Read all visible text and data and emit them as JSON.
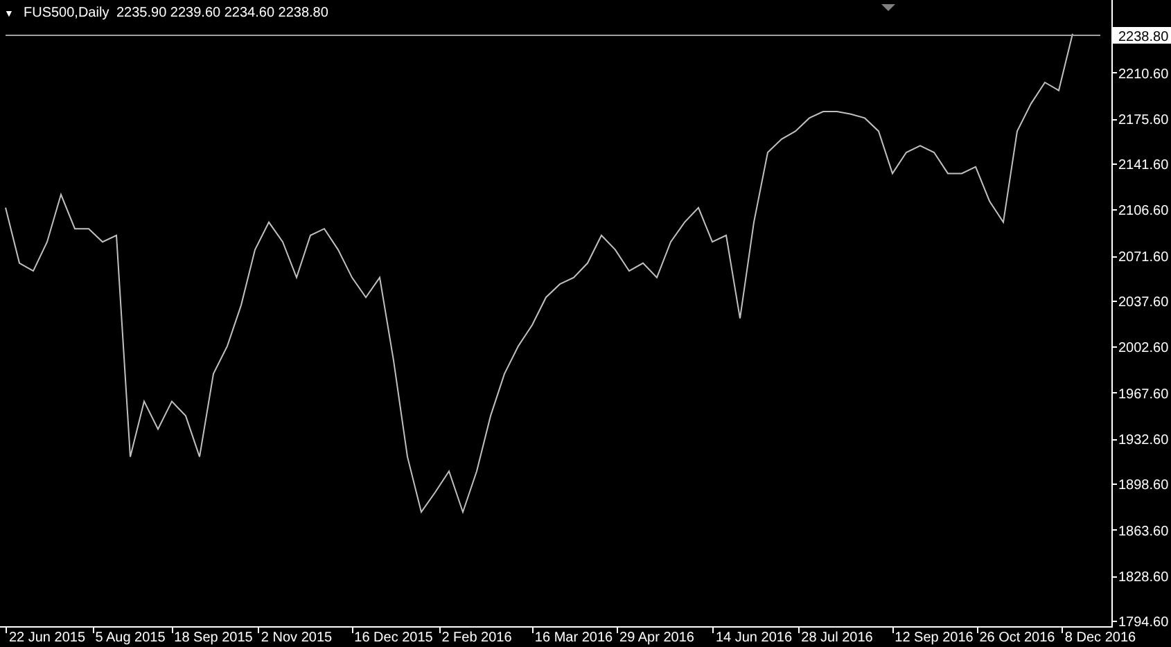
{
  "chart_header": {
    "symbol": "FUS500,Daily",
    "ohlc": "2235.90 2239.60 2234.60 2238.80",
    "menu_glyph": "▼"
  },
  "price_tag": "2238.80",
  "chart_data": {
    "type": "line",
    "ylim": [
      1790.4,
      2265.6
    ],
    "categories": [
      null,
      null,
      null,
      "22 Jun 2015",
      null,
      null,
      null,
      null,
      null,
      "5 Aug 2015",
      null,
      null,
      null,
      null,
      null,
      "18 Sep 2015",
      null,
      null,
      null,
      null,
      null,
      "2 Nov 2015",
      null,
      null,
      null,
      null,
      null,
      null,
      "16 Dec 2015",
      null,
      null,
      null,
      null,
      null,
      "2 Feb 2016",
      null,
      null,
      null,
      null,
      null,
      null,
      "16 Mar 2016",
      null,
      null,
      null,
      null,
      null,
      "29 Apr 2016",
      null,
      null,
      null,
      null,
      null,
      null,
      "14 Jun 2016",
      null,
      null,
      null,
      null,
      null,
      "28 Jul 2016",
      null,
      null,
      null,
      null,
      null,
      null,
      "12 Sep 2016",
      null,
      null,
      null,
      null,
      null,
      "26 Oct 2016",
      null,
      null,
      null,
      null,
      null,
      "8 Dec 2016"
    ],
    "yticks": [
      {
        "value": 2210.6,
        "label": "2210.60"
      },
      {
        "value": 2175.6,
        "label": "2175.60"
      },
      {
        "value": 2141.6,
        "label": "2141.60"
      },
      {
        "value": 2106.6,
        "label": "2106.60"
      },
      {
        "value": 2071.6,
        "label": "2071.60"
      },
      {
        "value": 2037.6,
        "label": "2037.60"
      },
      {
        "value": 2002.6,
        "label": "2002.60"
      },
      {
        "value": 1967.6,
        "label": "1967.60"
      },
      {
        "value": 1932.6,
        "label": "1932.60"
      },
      {
        "value": 1898.6,
        "label": "1898.60"
      },
      {
        "value": 1863.6,
        "label": "1863.60"
      },
      {
        "value": 1828.6,
        "label": "1828.60"
      },
      {
        "value": 1794.6,
        "label": "1794.60"
      }
    ],
    "series": [
      {
        "color": "#c0c0c0",
        "values": [
          2108,
          2066,
          2060,
          2082,
          2118,
          2092,
          2092,
          2082,
          2087,
          1919,
          1961,
          1940,
          1961,
          1950,
          1919,
          1982,
          2003,
          2034,
          2076,
          2097,
          2082,
          2055,
          2087,
          2092,
          2076,
          2055,
          2040,
          2055,
          1992,
          1919,
          1877,
          1892,
          1908,
          1877,
          1908,
          1950,
          1982,
          2003,
          2019,
          2040,
          2050,
          2055,
          2066,
          2087,
          2076,
          2060,
          2066,
          2055,
          2082,
          2097,
          2108,
          2082,
          2087,
          2024,
          2097,
          2150,
          2160,
          2166,
          2176,
          2181,
          2181,
          2179,
          2176,
          2166,
          2134,
          2150,
          2155,
          2150,
          2134,
          2134,
          2139,
          2113,
          2097,
          2166,
          2187,
          2203,
          2197,
          2240,
          null,
          null
        ]
      },
      {
        "color": "#a0a0a0",
        "values": [
          2238.8,
          2238.8,
          2238.8,
          2238.8,
          2238.8,
          2238.8,
          2238.8,
          2238.8,
          2238.8,
          2238.8,
          2238.8,
          2238.8,
          2238.8,
          2238.8,
          2238.8,
          2238.8,
          2238.8,
          2238.8,
          2238.8,
          2238.8,
          2238.8,
          2238.8,
          2238.8,
          2238.8,
          2238.8,
          2238.8,
          2238.8,
          2238.8,
          2238.8,
          2238.8,
          2238.8,
          2238.8,
          2238.8,
          2238.8,
          2238.8,
          2238.8,
          2238.8,
          2238.8,
          2238.8,
          2238.8,
          2238.8,
          2238.8,
          2238.8,
          2238.8,
          2238.8,
          2238.8,
          2238.8,
          2238.8,
          2238.8,
          2238.8,
          2238.8,
          2238.8,
          2238.8,
          2238.8,
          2238.8,
          2238.8,
          2238.8,
          2238.8,
          2238.8,
          2238.8,
          2238.8,
          2238.8,
          2238.8,
          2238.8,
          2238.8,
          2238.8,
          2238.8,
          2238.8,
          2238.8,
          2238.8,
          2238.8,
          2238.8,
          2238.8,
          2238.8,
          2238.8,
          2238.8,
          2238.8,
          2238.8,
          2238.8,
          2238.8
        ]
      }
    ]
  }
}
